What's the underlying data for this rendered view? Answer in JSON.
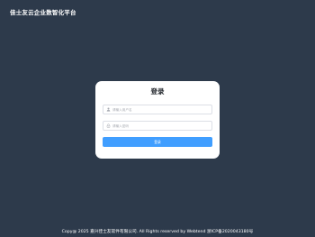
{
  "header": {
    "brand_title": "佳士友云企业数智化平台"
  },
  "login": {
    "title": "登录",
    "username_placeholder": "请输入用户名",
    "password_placeholder": "请输入密码",
    "submit_label": "登录",
    "username_icon": "user-icon",
    "password_icon": "lock-icon"
  },
  "footer": {
    "copyright": "Copy@ 2025 嘉兴佳士友软件有限公司. All Rights reserved by Webtend 浙ICP备2020043180号"
  },
  "colors": {
    "background": "#2d3a4b",
    "card": "#ffffff",
    "primary": "#409eff"
  }
}
